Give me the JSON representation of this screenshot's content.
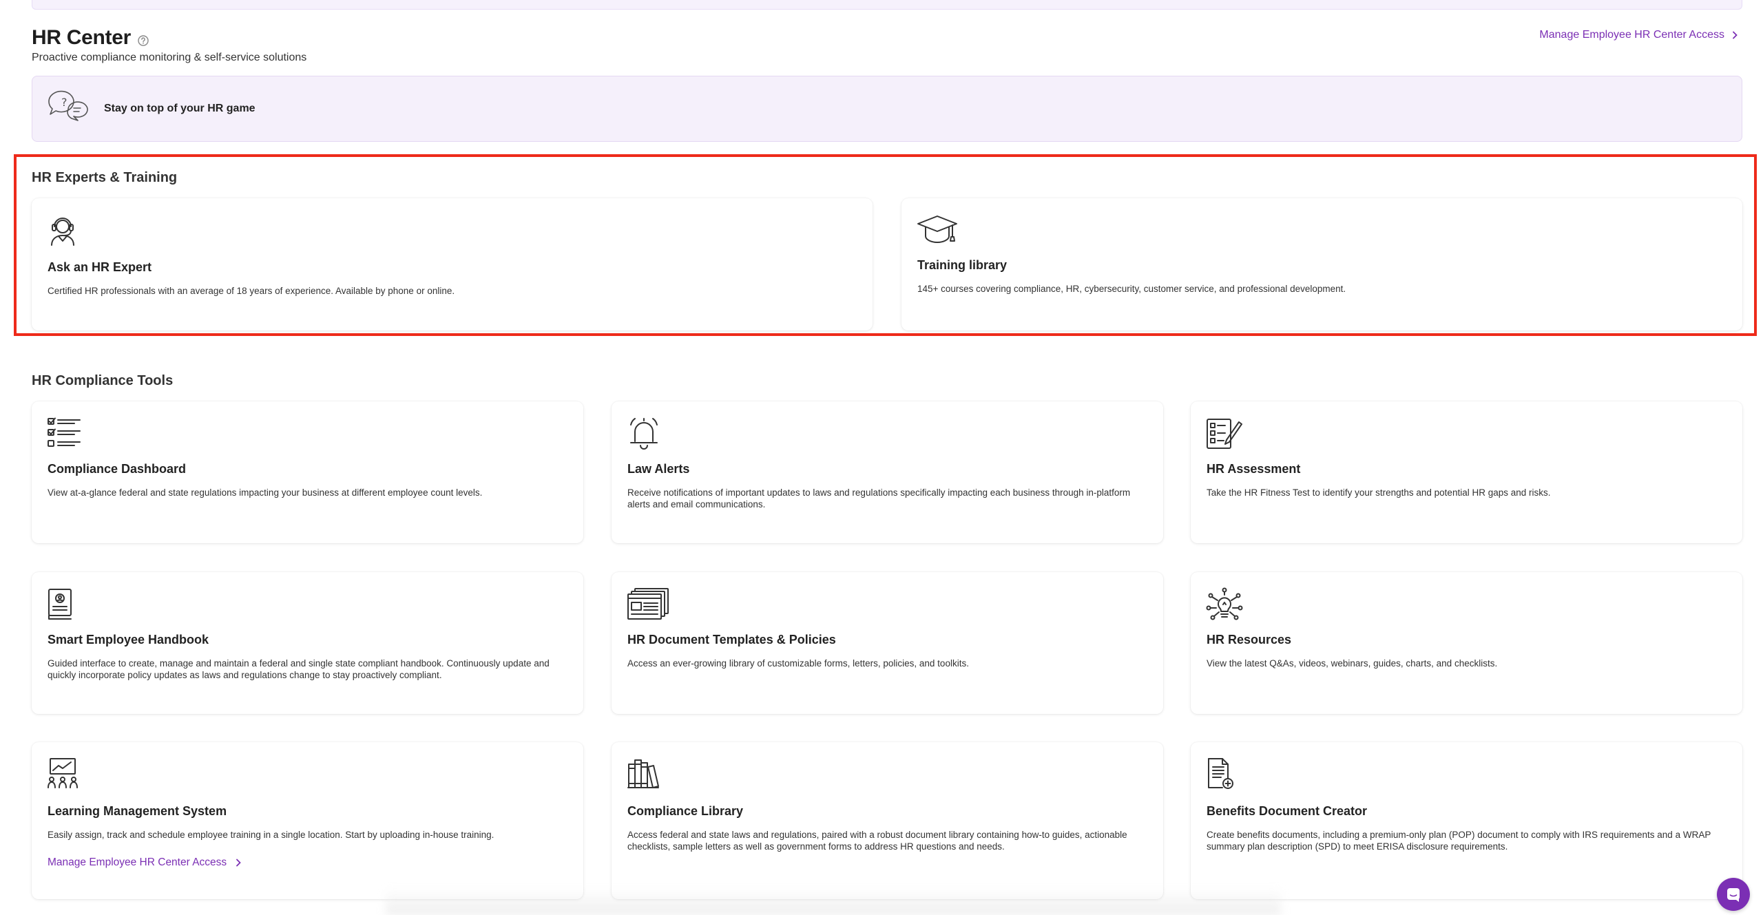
{
  "header": {
    "title": "HR Center",
    "subtitle": "Proactive compliance monitoring & self-service solutions",
    "manage_link": "Manage Employee HR Center Access"
  },
  "banner": {
    "text": "Stay on top of your HR game"
  },
  "experts_section": {
    "title": "HR Experts & Training",
    "cards": [
      {
        "title": "Ask an HR Expert",
        "description": "Certified HR professionals with an average of 18 years of experience. Available by phone or online.",
        "icon": "headset-agent-icon"
      },
      {
        "title": "Training library",
        "description": "145+ courses covering compliance, HR, cybersecurity, customer service, and professional development.",
        "icon": "graduation-cap-icon"
      }
    ]
  },
  "tools_section": {
    "title": "HR Compliance Tools",
    "cards": [
      {
        "title": "Compliance Dashboard",
        "description": "View at-a-glance federal and state regulations impacting your business at different employee count levels.",
        "icon": "checklist-icon"
      },
      {
        "title": "Law Alerts",
        "description": "Receive notifications of important updates to laws and regulations specifically impacting each business through in-platform alerts and email communications.",
        "icon": "bell-icon"
      },
      {
        "title": "HR Assessment",
        "description": "Take the HR Fitness Test to identify your strengths and potential HR gaps and risks.",
        "icon": "assessment-icon"
      },
      {
        "title": "Smart Employee Handbook",
        "description": "Guided interface to create, manage and maintain a federal and single state compliant handbook. Continuously update and quickly incorporate policy updates as laws and regulations change to stay proactively compliant.",
        "icon": "handbook-icon"
      },
      {
        "title": "HR Document Templates & Policies",
        "description": "Access an ever-growing library of customizable forms, letters, policies, and toolkits.",
        "icon": "document-templates-icon"
      },
      {
        "title": "HR Resources",
        "description": "View the latest Q&As, videos, webinars, guides, charts, and checklists.",
        "icon": "lightbulb-network-icon"
      },
      {
        "title": "Learning Management System",
        "description": "Easily assign, track and schedule employee training in a single location. Start by uploading in-house training.",
        "icon": "presentation-icon",
        "link": "Manage Employee HR Center Access"
      },
      {
        "title": "Compliance Library",
        "description": "Access federal and state laws and regulations, paired with a robust document library containing how-to guides, actionable checklists, sample letters as well as government forms to address HR questions and needs.",
        "icon": "books-icon"
      },
      {
        "title": "Benefits Document Creator",
        "description": "Create benefits documents, including a premium-only plan (POP) document to comply with IRS requirements and a WRAP summary plan description (SPD) to meet ERISA disclosure requirements.",
        "icon": "document-add-icon"
      }
    ]
  },
  "colors": {
    "accent": "#7b2fb4",
    "banner_bg": "#f5f0fb",
    "highlight": "#ee2a1a"
  }
}
